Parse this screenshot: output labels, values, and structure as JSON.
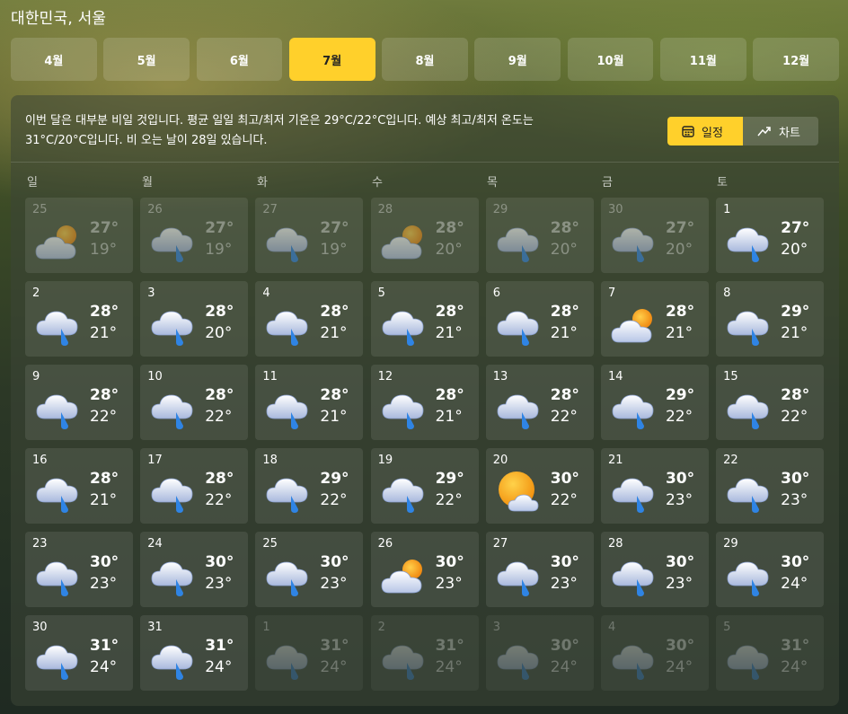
{
  "location": "대한민국, 서울",
  "months": [
    "4월",
    "5월",
    "6월",
    "7월",
    "8월",
    "9월",
    "10월",
    "11월",
    "12월"
  ],
  "selected_month": "7월",
  "summary": "이번 달은 대부분 비일 것입니다. 평균 일일 최고/최저 기온은 29°C/22°C입니다. 예상 최고/최저 온도는 31°C/20°C입니다. 비 오는 날이 28일 있습니다.",
  "view_toggle": {
    "calendar_label": "일정",
    "chart_label": "차트"
  },
  "weekdays": [
    "일",
    "월",
    "화",
    "수",
    "목",
    "금",
    "토"
  ],
  "colors": {
    "accent": "#ffd02b"
  },
  "days": [
    {
      "day": "25",
      "hi": "27°",
      "lo": "19°",
      "icon": "partly-cloudy-icon",
      "state": "dim"
    },
    {
      "day": "26",
      "hi": "27°",
      "lo": "19°",
      "icon": "rain-icon",
      "state": "dim"
    },
    {
      "day": "27",
      "hi": "27°",
      "lo": "19°",
      "icon": "rain-icon",
      "state": "dim"
    },
    {
      "day": "28",
      "hi": "28°",
      "lo": "20°",
      "icon": "partly-cloudy-icon",
      "state": "dim"
    },
    {
      "day": "29",
      "hi": "28°",
      "lo": "20°",
      "icon": "rain-icon",
      "state": "dim"
    },
    {
      "day": "30",
      "hi": "27°",
      "lo": "20°",
      "icon": "rain-icon",
      "state": "dim"
    },
    {
      "day": "1",
      "hi": "27°",
      "lo": "20°",
      "icon": "rain-icon",
      "state": "normal"
    },
    {
      "day": "2",
      "hi": "28°",
      "lo": "21°",
      "icon": "rain-icon",
      "state": "normal"
    },
    {
      "day": "3",
      "hi": "28°",
      "lo": "20°",
      "icon": "rain-icon",
      "state": "normal"
    },
    {
      "day": "4",
      "hi": "28°",
      "lo": "21°",
      "icon": "rain-icon",
      "state": "normal"
    },
    {
      "day": "5",
      "hi": "28°",
      "lo": "21°",
      "icon": "rain-icon",
      "state": "normal"
    },
    {
      "day": "6",
      "hi": "28°",
      "lo": "21°",
      "icon": "rain-icon",
      "state": "normal"
    },
    {
      "day": "7",
      "hi": "28°",
      "lo": "21°",
      "icon": "partly-cloudy-icon",
      "state": "normal"
    },
    {
      "day": "8",
      "hi": "29°",
      "lo": "21°",
      "icon": "rain-icon",
      "state": "normal"
    },
    {
      "day": "9",
      "hi": "28°",
      "lo": "22°",
      "icon": "rain-icon",
      "state": "normal"
    },
    {
      "day": "10",
      "hi": "28°",
      "lo": "22°",
      "icon": "rain-icon",
      "state": "normal"
    },
    {
      "day": "11",
      "hi": "28°",
      "lo": "21°",
      "icon": "rain-icon",
      "state": "normal"
    },
    {
      "day": "12",
      "hi": "28°",
      "lo": "21°",
      "icon": "rain-icon",
      "state": "normal"
    },
    {
      "day": "13",
      "hi": "28°",
      "lo": "22°",
      "icon": "rain-icon",
      "state": "normal"
    },
    {
      "day": "14",
      "hi": "29°",
      "lo": "22°",
      "icon": "rain-icon",
      "state": "normal"
    },
    {
      "day": "15",
      "hi": "28°",
      "lo": "22°",
      "icon": "rain-icon",
      "state": "normal"
    },
    {
      "day": "16",
      "hi": "28°",
      "lo": "21°",
      "icon": "rain-icon",
      "state": "normal"
    },
    {
      "day": "17",
      "hi": "28°",
      "lo": "22°",
      "icon": "rain-icon",
      "state": "normal"
    },
    {
      "day": "18",
      "hi": "29°",
      "lo": "22°",
      "icon": "rain-icon",
      "state": "normal"
    },
    {
      "day": "19",
      "hi": "29°",
      "lo": "22°",
      "icon": "rain-icon",
      "state": "normal"
    },
    {
      "day": "20",
      "hi": "30°",
      "lo": "22°",
      "icon": "mostly-sunny-icon",
      "state": "normal"
    },
    {
      "day": "21",
      "hi": "30°",
      "lo": "23°",
      "icon": "rain-icon",
      "state": "normal"
    },
    {
      "day": "22",
      "hi": "30°",
      "lo": "23°",
      "icon": "rain-icon",
      "state": "normal"
    },
    {
      "day": "23",
      "hi": "30°",
      "lo": "23°",
      "icon": "rain-icon",
      "state": "normal"
    },
    {
      "day": "24",
      "hi": "30°",
      "lo": "23°",
      "icon": "rain-icon",
      "state": "normal"
    },
    {
      "day": "25",
      "hi": "30°",
      "lo": "23°",
      "icon": "rain-icon",
      "state": "normal"
    },
    {
      "day": "26",
      "hi": "30°",
      "lo": "23°",
      "icon": "partly-cloudy-icon",
      "state": "normal"
    },
    {
      "day": "27",
      "hi": "30°",
      "lo": "23°",
      "icon": "rain-icon",
      "state": "normal"
    },
    {
      "day": "28",
      "hi": "30°",
      "lo": "23°",
      "icon": "rain-icon",
      "state": "normal"
    },
    {
      "day": "29",
      "hi": "30°",
      "lo": "24°",
      "icon": "rain-icon",
      "state": "normal"
    },
    {
      "day": "30",
      "hi": "31°",
      "lo": "24°",
      "icon": "rain-icon",
      "state": "normal"
    },
    {
      "day": "31",
      "hi": "31°",
      "lo": "24°",
      "icon": "rain-icon",
      "state": "normal"
    },
    {
      "day": "1",
      "hi": "31°",
      "lo": "24°",
      "icon": "rain-icon",
      "state": "outside"
    },
    {
      "day": "2",
      "hi": "31°",
      "lo": "24°",
      "icon": "rain-icon",
      "state": "outside"
    },
    {
      "day": "3",
      "hi": "30°",
      "lo": "24°",
      "icon": "rain-icon",
      "state": "outside"
    },
    {
      "day": "4",
      "hi": "30°",
      "lo": "24°",
      "icon": "rain-icon",
      "state": "outside"
    },
    {
      "day": "5",
      "hi": "31°",
      "lo": "24°",
      "icon": "rain-icon",
      "state": "outside"
    }
  ]
}
